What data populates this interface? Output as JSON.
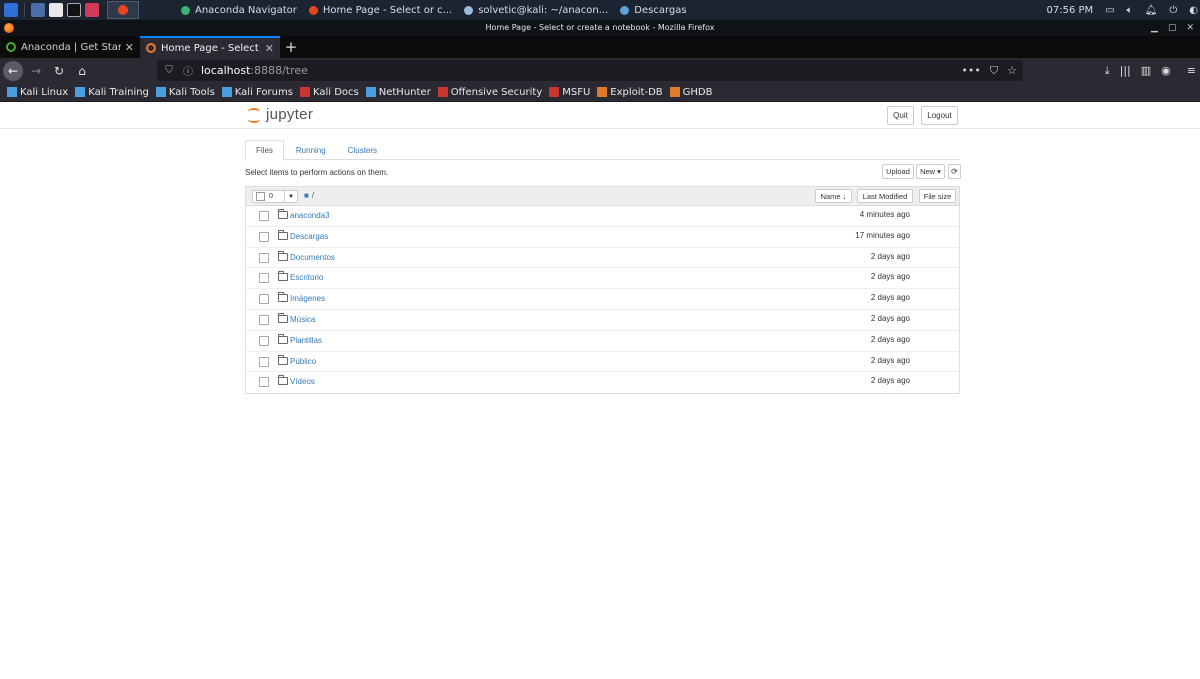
{
  "taskbar": {
    "tasks": [
      {
        "label": "Anaconda Navigator",
        "color": "#3cb371"
      },
      {
        "label": "Home Page - Select or c...",
        "color": "#e8451f"
      },
      {
        "label": "solvetic@kali: ~/anacon...",
        "color": "#9bd"
      },
      {
        "label": "Descargas",
        "color": "#5ba3d9"
      }
    ],
    "clock": "07:56 PM"
  },
  "window": {
    "title": "Home Page - Select or create a notebook - Mozilla Firefox"
  },
  "browser": {
    "tabs": [
      {
        "label": "Anaconda | Get Started",
        "active": false
      },
      {
        "label": "Home Page - Select or cr",
        "active": true
      }
    ],
    "url_host": "localhost",
    "url_rest": ":8888/tree",
    "bookmarks": [
      "Kali Linux",
      "Kali Training",
      "Kali Tools",
      "Kali Forums",
      "Kali Docs",
      "NetHunter",
      "Offensive Security",
      "MSFU",
      "Exploit-DB",
      "GHDB"
    ]
  },
  "jupyter": {
    "logo_text": "jupyter",
    "quit_label": "Quit",
    "logout_label": "Logout",
    "tabs": [
      "Files",
      "Running",
      "Clusters"
    ],
    "instruction": "Select items to perform actions on them.",
    "upload_label": "Upload",
    "new_label": "New ▾",
    "refresh_icon": "refresh-icon",
    "selected_count": "0",
    "breadcrumb": "/",
    "columns": {
      "name": "Name ↓",
      "last_modified": "Last Modified",
      "file_size": "File size"
    },
    "files": [
      {
        "name": "anaconda3",
        "modified": "4 minutes ago"
      },
      {
        "name": "Descargas",
        "modified": "17 minutes ago"
      },
      {
        "name": "Documentos",
        "modified": "2 days ago"
      },
      {
        "name": "Escritorio",
        "modified": "2 days ago"
      },
      {
        "name": "Imágenes",
        "modified": "2 days ago"
      },
      {
        "name": "Música",
        "modified": "2 days ago"
      },
      {
        "name": "Plantillas",
        "modified": "2 days ago"
      },
      {
        "name": "Público",
        "modified": "2 days ago"
      },
      {
        "name": "Vídeos",
        "modified": "2 days ago"
      }
    ]
  }
}
